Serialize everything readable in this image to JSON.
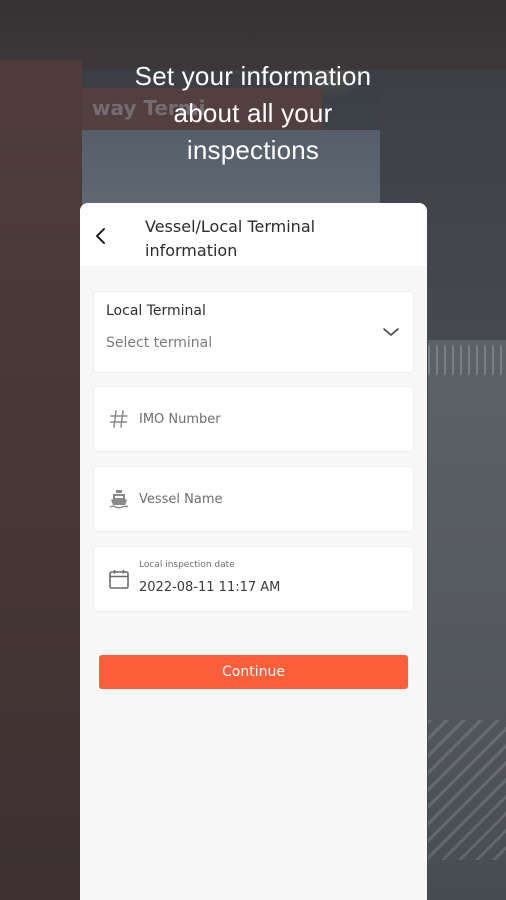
{
  "headline": {
    "line1": "Set your information",
    "line2": "about all your",
    "line3": "inspections"
  },
  "background": {
    "sign_text": "way Termi"
  },
  "card": {
    "title_line1": "Vessel/Local Terminal",
    "title_line2": "information"
  },
  "form": {
    "terminal": {
      "label": "Local Terminal",
      "value": "Select terminal"
    },
    "imo": {
      "placeholder": "IMO Number",
      "value": ""
    },
    "vessel": {
      "placeholder": "Vessel Name",
      "value": ""
    },
    "date": {
      "label": "Local inspection date",
      "value": "2022-08-11 11:17 AM"
    },
    "continue_label": "Continue"
  },
  "icons": {
    "back": "arrow-left-icon",
    "dropdown": "chevron-down-icon",
    "imo": "hash-icon",
    "vessel": "ship-icon",
    "date": "calendar-icon"
  },
  "colors": {
    "accent": "#ff5e3a",
    "card_bg": "#f7f7f7",
    "headline_text": "#ffffff"
  }
}
